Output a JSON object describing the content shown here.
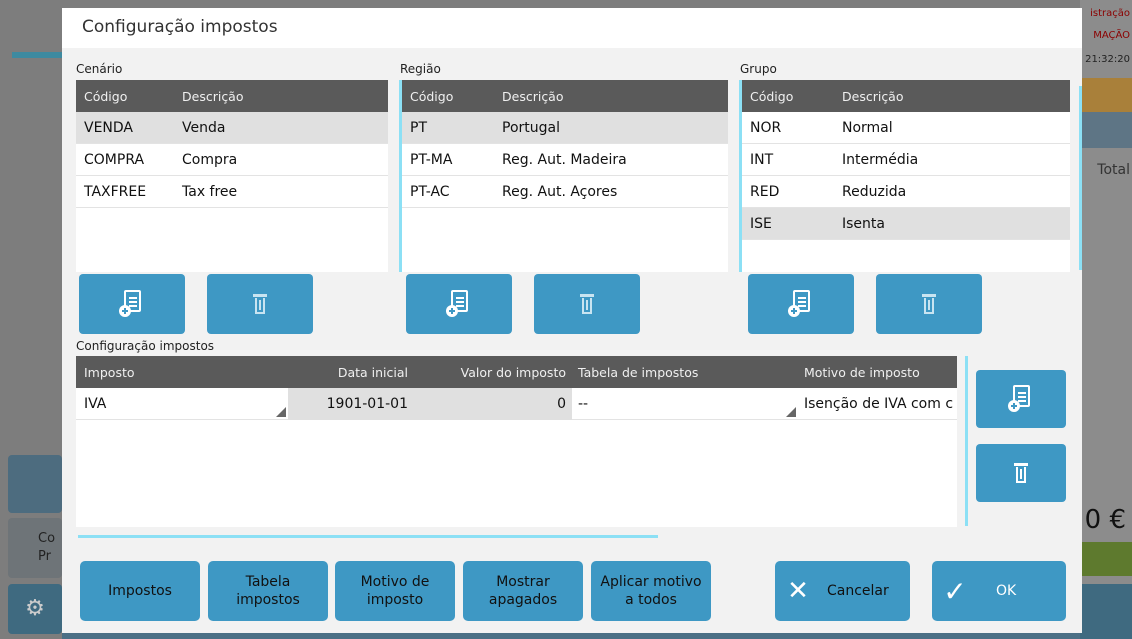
{
  "background": {
    "right_labels": [
      "istração",
      "MAÇÃO"
    ],
    "time": "21:32:20",
    "total_label": "Total",
    "amount": "0 €",
    "left_tile_text": [
      "Co",
      "Pr"
    ]
  },
  "dialog": {
    "title": "Configuração impostos",
    "cenario": {
      "label": "Cenário",
      "headers": [
        "Código",
        "Descrição"
      ],
      "rows": [
        {
          "code": "VENDA",
          "desc": "Venda"
        },
        {
          "code": "COMPRA",
          "desc": "Compra"
        },
        {
          "code": "TAXFREE",
          "desc": "Tax free"
        }
      ]
    },
    "regiao": {
      "label": "Região",
      "headers": [
        "Código",
        "Descrição"
      ],
      "rows": [
        {
          "code": "PT",
          "desc": "Portugal"
        },
        {
          "code": "PT-MA",
          "desc": "Reg. Aut. Madeira"
        },
        {
          "code": "PT-AC",
          "desc": "Reg. Aut. Açores"
        }
      ]
    },
    "grupo": {
      "label": "Grupo",
      "headers": [
        "Código",
        "Descrição"
      ],
      "rows": [
        {
          "code": "NOR",
          "desc": "Normal"
        },
        {
          "code": "INT",
          "desc": "Intermédia"
        },
        {
          "code": "RED",
          "desc": "Reduzida"
        },
        {
          "code": "ISE",
          "desc": "Isenta"
        }
      ]
    },
    "config": {
      "label": "Configuração impostos",
      "headers": [
        "Imposto",
        "Data inicial",
        "Valor do imposto",
        "Tabela de impostos",
        "Motivo de imposto"
      ],
      "rows": [
        {
          "imposto": "IVA",
          "data": "1901-01-01",
          "valor": "0",
          "tabela": "--",
          "motivo": "Isenção de IVA com c"
        }
      ]
    },
    "buttons": {
      "impostos": "Impostos",
      "tabela_1": "Tabela",
      "tabela_2": "impostos",
      "motivo_1": "Motivo de",
      "motivo_2": "imposto",
      "mostrar_1": "Mostrar",
      "mostrar_2": "apagados",
      "aplicar_1": "Aplicar motivo",
      "aplicar_2": "a todos",
      "cancelar": "Cancelar",
      "ok": "OK"
    }
  }
}
